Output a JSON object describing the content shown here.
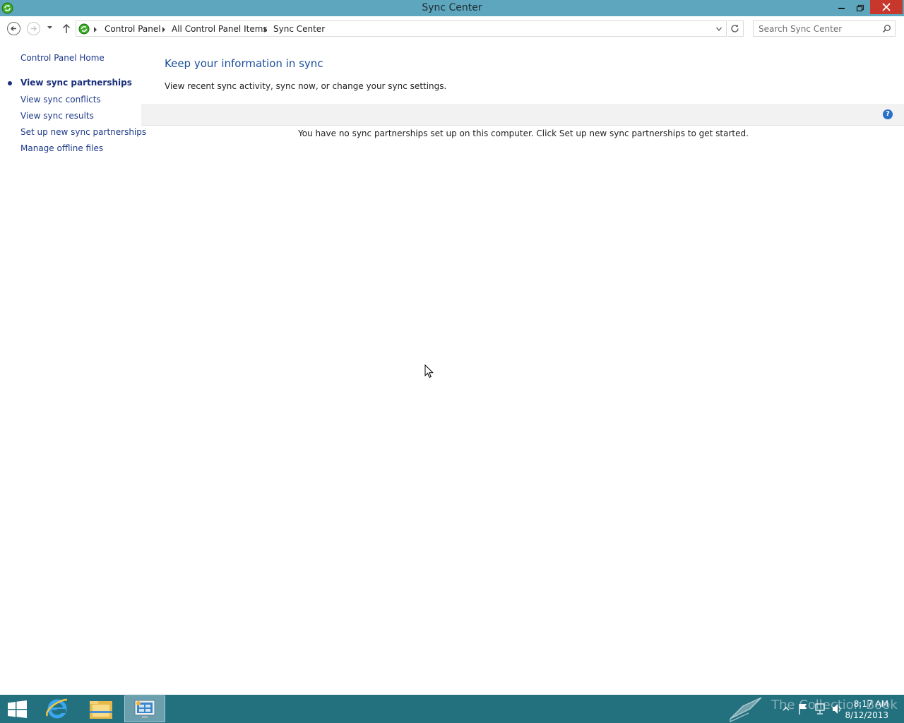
{
  "window": {
    "title": "Sync Center"
  },
  "address_bar": {
    "breadcrumbs": [
      "Control Panel",
      "All Control Panel Items",
      "Sync Center"
    ]
  },
  "search": {
    "placeholder": "Search Sync Center"
  },
  "sidebar": {
    "home_link": "Control Panel Home",
    "items": [
      {
        "label": "View sync partnerships",
        "active": true
      },
      {
        "label": "View sync conflicts",
        "active": false
      },
      {
        "label": "View sync results",
        "active": false
      },
      {
        "label": "Set up new sync partnerships",
        "active": false
      },
      {
        "label": "Manage offline files",
        "active": false
      }
    ]
  },
  "main": {
    "heading": "Keep your information in sync",
    "subtitle": "View recent sync activity, sync now, or change your sync settings.",
    "empty_message": "You have no sync partnerships set up on this computer. Click Set up new sync partnerships to get started.",
    "help_glyph": "?"
  },
  "taskbar": {
    "time": "8:17 AM",
    "date": "8/12/2013",
    "watermark": "The Collection Book",
    "pinned": [
      "internet-explorer-icon",
      "file-explorer-icon",
      "control-panel-icon"
    ]
  },
  "colors": {
    "titlebar": "#5ea6bd",
    "taskbar": "#23707f",
    "close_button": "#c7372c",
    "link": "#1e3a8a",
    "heading": "#1b4f9b"
  }
}
